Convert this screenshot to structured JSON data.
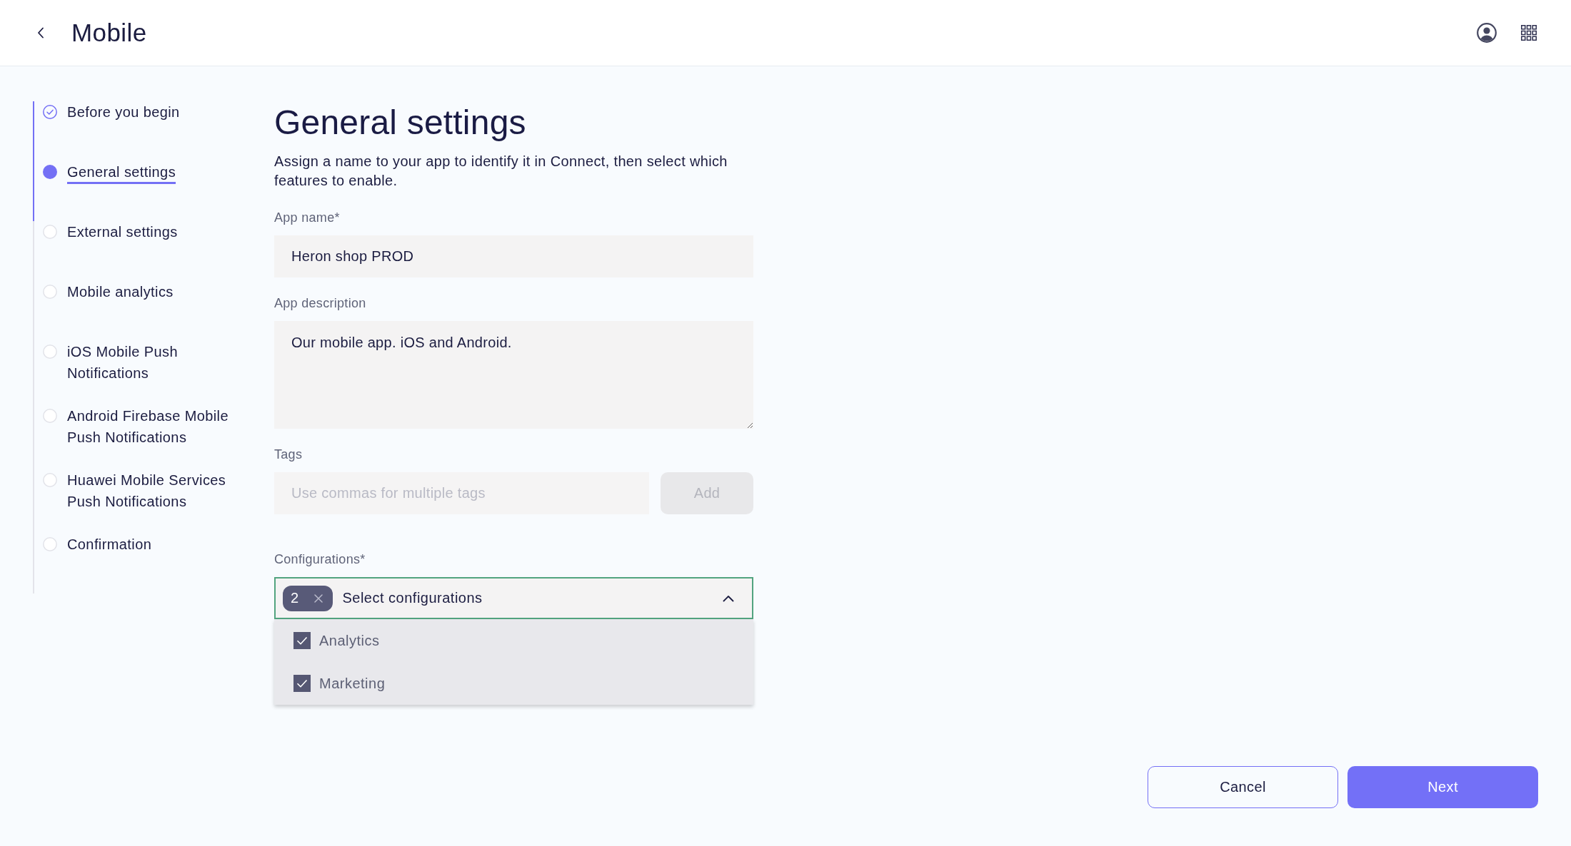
{
  "header": {
    "title": "Mobile"
  },
  "steps": [
    {
      "label": "Before you begin",
      "completed": true,
      "selected": false
    },
    {
      "label": "General settings",
      "completed": false,
      "selected": true
    },
    {
      "label": "External settings",
      "completed": false,
      "selected": false
    },
    {
      "label": "Mobile analytics",
      "completed": false,
      "selected": false
    },
    {
      "label": "iOS Mobile Push Notifications",
      "completed": false,
      "selected": false
    },
    {
      "label": "Android Firebase Mobile Push Notifications",
      "completed": false,
      "selected": false
    },
    {
      "label": "Huawei Mobile Services Push Notifications",
      "completed": false,
      "selected": false
    },
    {
      "label": "Confirmation",
      "completed": false,
      "selected": false
    }
  ],
  "page": {
    "title": "General settings",
    "description": "Assign a name to your app to identify it in Connect, then select which features to enable."
  },
  "form": {
    "app_name": {
      "label": "App name*",
      "value": "Heron shop PROD"
    },
    "app_description": {
      "label": "App description",
      "value": "Our mobile app. iOS and Android."
    },
    "tags": {
      "label": "Tags",
      "placeholder": "Use commas for multiple tags",
      "add_button": {
        "label": "Add",
        "disabled": true
      }
    },
    "configurations": {
      "label": "Configurations*",
      "count": "2",
      "text": "Select configurations",
      "expanded": true,
      "options": [
        {
          "label": "Analytics",
          "checked": true
        },
        {
          "label": "Marketing",
          "checked": true
        }
      ]
    }
  },
  "actions": [
    {
      "label": "Cancel",
      "kind": "secondary"
    },
    {
      "label": "Next",
      "kind": "primary"
    }
  ]
}
